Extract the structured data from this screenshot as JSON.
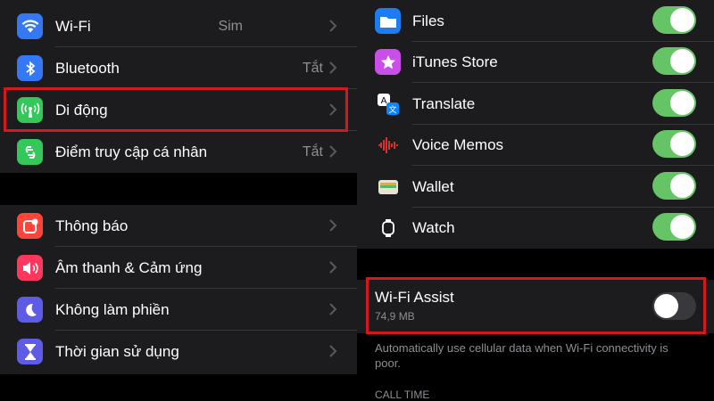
{
  "left": {
    "group1": [
      {
        "label": "Wi-Fi",
        "value": "Sim",
        "icon": "wifi-icon",
        "color": "#3478f6"
      },
      {
        "label": "Bluetooth",
        "value": "Tắt",
        "icon": "bluetooth-icon",
        "color": "#3478f6"
      },
      {
        "label": "Di động",
        "value": "",
        "icon": "antenna-icon",
        "color": "#34c759"
      },
      {
        "label": "Điểm truy cập cá nhân",
        "value": "Tắt",
        "icon": "hotspot-icon",
        "color": "#34c759"
      }
    ],
    "group2": [
      {
        "label": "Thông báo",
        "icon": "notification-icon",
        "color": "#ff453a"
      },
      {
        "label": "Âm thanh & Cảm ứng",
        "icon": "speaker-icon",
        "color": "#ff375f"
      },
      {
        "label": "Không làm phiền",
        "icon": "moon-icon",
        "color": "#5e5ce6"
      },
      {
        "label": "Thời gian sử dụng",
        "icon": "hourglass-icon",
        "color": "#5e5ce6"
      }
    ]
  },
  "right": {
    "apps": [
      {
        "label": "Files",
        "icon": "files-icon",
        "color": "#1e7cf2",
        "on": true
      },
      {
        "label": "iTunes Store",
        "icon": "star-icon",
        "color": "#c94fe8",
        "on": true
      },
      {
        "label": "Translate",
        "icon": "translate-icon",
        "color": "#0a84ff",
        "on": true
      },
      {
        "label": "Voice Memos",
        "icon": "waveform-icon",
        "color": "#1c1c1e",
        "on": true
      },
      {
        "label": "Wallet",
        "icon": "wallet-icon",
        "color": "#1c1c1e",
        "on": true
      },
      {
        "label": "Watch",
        "icon": "watch-icon",
        "color": "#1c1c1e",
        "on": true
      }
    ],
    "wifi_assist": {
      "label": "Wi-Fi Assist",
      "sub": "74,9 MB",
      "on": false
    },
    "footer_note": "Automatically use cellular data when Wi-Fi connectivity is poor.",
    "section_header": "CALL TIME"
  },
  "colors": {
    "highlight": "#d2191f",
    "toggle_on": "#65c466"
  }
}
